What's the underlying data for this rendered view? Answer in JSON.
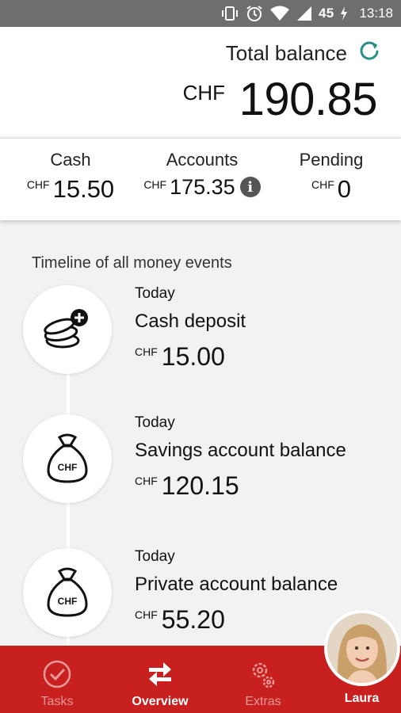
{
  "status_bar": {
    "battery_text": "45",
    "time": "13:18",
    "icons": [
      "vibrate-icon",
      "alarm-icon",
      "wifi-icon",
      "signal-icon",
      "battery-charging-icon"
    ]
  },
  "header": {
    "total_label": "Total balance",
    "currency": "CHF",
    "amount": "190.85",
    "refresh_icon": "refresh-icon"
  },
  "summary": {
    "cash": {
      "label": "Cash",
      "currency": "CHF",
      "amount": "15.50"
    },
    "accounts": {
      "label": "Accounts",
      "currency": "CHF",
      "amount": "175.35",
      "info_icon": "info-icon"
    },
    "pending": {
      "label": "Pending",
      "currency": "CHF",
      "amount": "0"
    }
  },
  "timeline": {
    "title": "Timeline of all money events",
    "events": [
      {
        "date": "Today",
        "title": "Cash deposit",
        "currency": "CHF",
        "amount": "15.00",
        "icon": "coins-plus-icon"
      },
      {
        "date": "Today",
        "title": "Savings account balance",
        "currency": "CHF",
        "amount": "120.15",
        "icon": "money-bag-icon",
        "icon_text": "CHF"
      },
      {
        "date": "Today",
        "title": "Private account balance",
        "currency": "CHF",
        "amount": "55.20",
        "icon": "money-bag-icon",
        "icon_text": "CHF"
      }
    ]
  },
  "bottom_nav": {
    "tasks": "Tasks",
    "overview": "Overview",
    "extras": "Extras",
    "profile": "Laura"
  },
  "colors": {
    "brand_red": "#c8201f",
    "refresh_teal": "#2a8f86",
    "status_bar": "#6e6e6e"
  }
}
